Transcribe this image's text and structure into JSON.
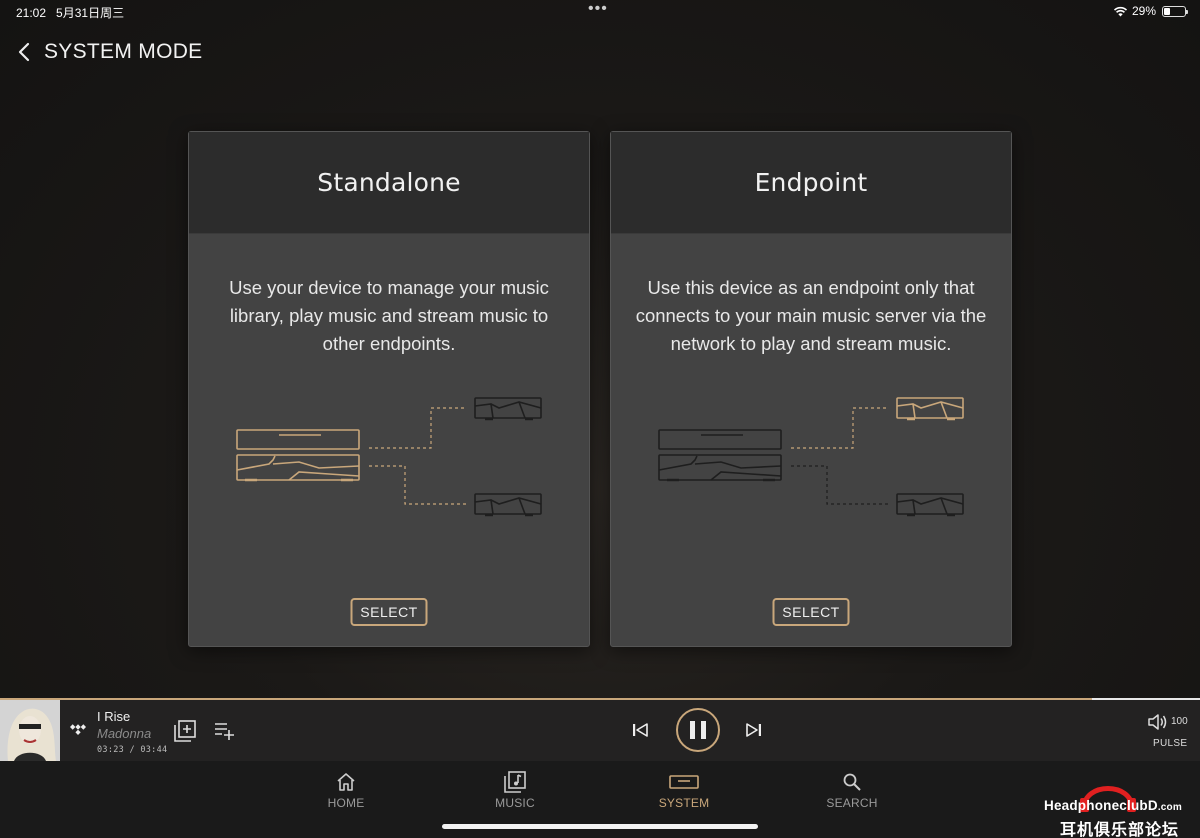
{
  "status_bar": {
    "time": "21:02",
    "date": "5月31日周三",
    "battery": "29%",
    "battery_level": 0.29
  },
  "header": {
    "title": "SYSTEM MODE"
  },
  "cards": [
    {
      "title": "Standalone",
      "description": "Use your device to manage your music library, play music and stream music to other endpoints.",
      "button": "SELECT"
    },
    {
      "title": "Endpoint",
      "description": "Use this device as an endpoint only that connects to your main music server via the network to play and stream music.",
      "button": "SELECT"
    }
  ],
  "player": {
    "track_title": "I Rise",
    "artist": "Madonna",
    "time": "03:23 / 03:44",
    "progress_fraction": 0.91,
    "volume": "100",
    "output": "PULSE"
  },
  "nav": {
    "items": [
      {
        "label": "HOME",
        "icon": "home-icon"
      },
      {
        "label": "MUSIC",
        "icon": "music-icon"
      },
      {
        "label": "SYSTEM",
        "icon": "system-icon",
        "active": true
      },
      {
        "label": "SEARCH",
        "icon": "search-icon"
      }
    ]
  },
  "watermark": {
    "line1": "HeadphoneclubD",
    "domain": ".com",
    "line2": "耳机俱乐部论坛"
  },
  "colors": {
    "accent": "#c9a77b",
    "card_bg": "#434343",
    "card_header_bg": "#2c2c2c",
    "player_bg": "#232222",
    "nav_bg": "#1a1a1a"
  }
}
